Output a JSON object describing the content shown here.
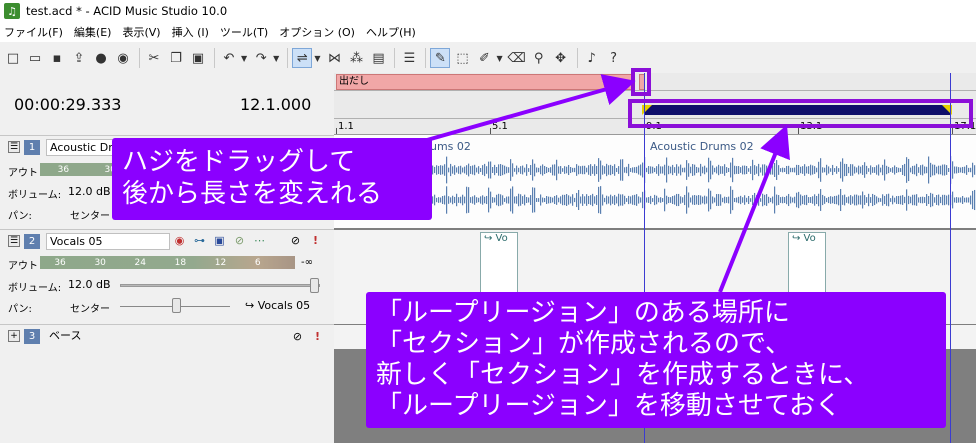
{
  "window": {
    "title": "test.acd * - ACID Music Studio 10.0",
    "app_icon_glyph": "♫"
  },
  "menu": [
    "ファイル(F)",
    "編集(E)",
    "表示(V)",
    "挿入 (I)",
    "ツール(T)",
    "オプション (O)",
    "ヘルプ(H)"
  ],
  "transport": {
    "time": "00:00:29.333",
    "bar_beat": "12.1.000"
  },
  "tracks": [
    {
      "num": "1",
      "name": "Acoustic Drums",
      "out_label": "アウト",
      "meter_ticks": [
        "36",
        "30"
      ],
      "volume_label": "ボリューム:",
      "volume_value": "12.0 dB",
      "pan_label": "パン:",
      "pan_value": "センター"
    },
    {
      "num": "2",
      "name": "Vocals 05",
      "out_label": "アウト",
      "meter_ticks": [
        "36",
        "30",
        "24",
        "18",
        "12",
        "6"
      ],
      "meter_end": "-∞",
      "volume_label": "ボリューム:",
      "volume_value": "12.0 dB",
      "pan_label": "パン:",
      "pan_value": "センター",
      "pan_target": "↪ Vocals 05"
    },
    {
      "num": "3",
      "name": "ベース"
    }
  ],
  "timeline": {
    "section_label": "出だし",
    "ruler": [
      {
        "label": "1.1"
      },
      {
        "label": "5.1"
      },
      {
        "label": "9.1"
      },
      {
        "label": "13.1"
      },
      {
        "label": "17.1"
      }
    ],
    "clip_labels": [
      "ums 02",
      "Acoustic Drums 02"
    ],
    "vocal_clip_label": "↪ Vo"
  },
  "annotations": {
    "callout1": [
      "ハジをドラッグして",
      "後から長さを変えれる"
    ],
    "callout2": [
      "「ループリージョン」のある場所に",
      "「セクション」が作成されるので、",
      "新しく「セクション」を作成するときに、",
      "「ループリージョン」を移動させておく"
    ]
  },
  "colors": {
    "annotation_purple": "#8b00ff",
    "section_pink": "#f1a7a7",
    "loop_bar": "#0f0f6b",
    "loop_ends": "#e6d000",
    "waveform": "#5a7fb0"
  },
  "icons": {
    "toolbar": [
      "new-icon",
      "open-icon",
      "save-icon",
      "render-icon",
      "user-icon",
      "explore-icon",
      "cut-icon",
      "copy-icon",
      "paste-icon",
      "undo-icon",
      "redo-icon",
      "snap-icon",
      "envelope-icon",
      "selection-icon",
      "scrub-icon",
      "properties-icon",
      "draw-tool-icon",
      "select-tool-icon",
      "paint-tool-icon",
      "erase-tool-icon",
      "envelope-tool-icon",
      "time-select-icon",
      "bell-icon",
      "help-icon"
    ]
  }
}
